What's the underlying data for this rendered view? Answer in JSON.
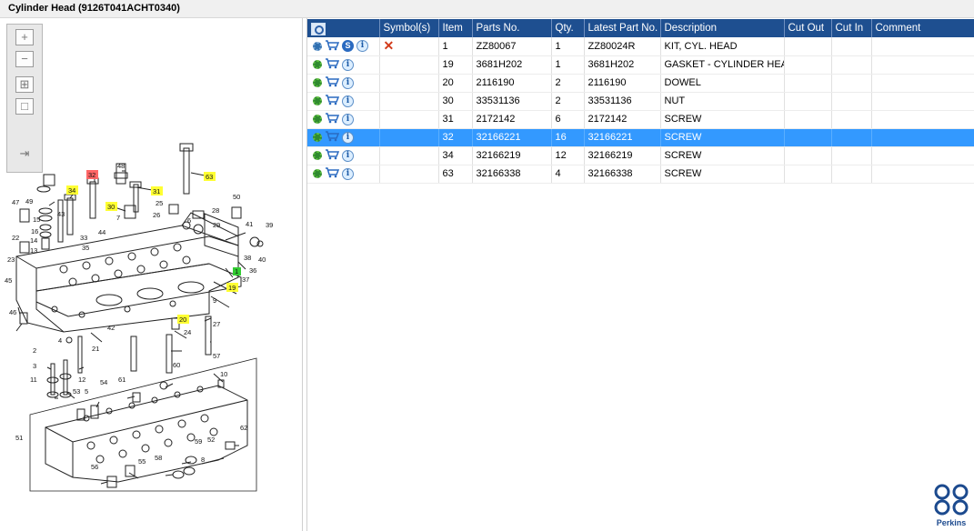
{
  "window": {
    "title": "Cylinder Head (9126T041ACHT0340)"
  },
  "toolbar": {
    "buttons": [
      {
        "name": "zoom-in",
        "glyph": "+"
      },
      {
        "name": "zoom-out",
        "glyph": "−"
      },
      {
        "name": "fit-all",
        "glyph": "⊞"
      },
      {
        "name": "actual-size",
        "glyph": "□"
      },
      {
        "name": "toggle-table",
        "glyph": "⇥"
      }
    ]
  },
  "table": {
    "columns": [
      "Symbol(s)",
      "Item",
      "Parts No.",
      "Qty.",
      "Latest Part No.",
      "Description",
      "Cut Out",
      "Cut In",
      "Comment"
    ],
    "rows": [
      {
        "icons": [
          "gear-pair",
          "cart",
          "s-badge",
          "info"
        ],
        "symbol": "✕",
        "item": "1",
        "part": "ZZ80067",
        "qty": "1",
        "latest": "ZZ80024R",
        "desc": "KIT, CYL. HEAD",
        "cutout": "",
        "cutin": "",
        "comment": ""
      },
      {
        "icons": [
          "gear",
          "cart",
          "info"
        ],
        "symbol": "",
        "item": "19",
        "part": "3681H202",
        "qty": "1",
        "latest": "3681H202",
        "desc": "GASKET - CYLINDER HEAD",
        "cutout": "",
        "cutin": "",
        "comment": ""
      },
      {
        "icons": [
          "gear",
          "cart",
          "info"
        ],
        "symbol": "",
        "item": "20",
        "part": "2116190",
        "qty": "2",
        "latest": "2116190",
        "desc": "DOWEL",
        "cutout": "",
        "cutin": "",
        "comment": ""
      },
      {
        "icons": [
          "gear",
          "cart",
          "info"
        ],
        "symbol": "",
        "item": "30",
        "part": "33531136",
        "qty": "2",
        "latest": "33531136",
        "desc": "NUT",
        "cutout": "",
        "cutin": "",
        "comment": ""
      },
      {
        "icons": [
          "gear",
          "cart",
          "info"
        ],
        "symbol": "",
        "item": "31",
        "part": "2172142",
        "qty": "6",
        "latest": "2172142",
        "desc": "SCREW",
        "cutout": "",
        "cutin": "",
        "comment": ""
      },
      {
        "icons": [
          "gear",
          "cart",
          "info"
        ],
        "symbol": "",
        "item": "32",
        "part": "32166221",
        "qty": "16",
        "latest": "32166221",
        "desc": "SCREW",
        "cutout": "",
        "cutin": "",
        "comment": "",
        "selected": true
      },
      {
        "icons": [
          "gear",
          "cart",
          "info"
        ],
        "symbol": "",
        "item": "34",
        "part": "32166219",
        "qty": "12",
        "latest": "32166219",
        "desc": "SCREW",
        "cutout": "",
        "cutin": "",
        "comment": ""
      },
      {
        "icons": [
          "gear",
          "cart",
          "info"
        ],
        "symbol": "",
        "item": "63",
        "part": "32166338",
        "qty": "4",
        "latest": "32166338",
        "desc": "SCREW",
        "cutout": "",
        "cutin": "",
        "comment": ""
      }
    ]
  },
  "diagram": {
    "callouts": [
      "48",
      "32",
      "31",
      "63",
      "34",
      "30",
      "49",
      "47",
      "15",
      "16",
      "14",
      "22",
      "13",
      "23",
      "43",
      "33",
      "35",
      "44",
      "7",
      "26",
      "25",
      "6",
      "28",
      "29",
      "50",
      "39",
      "41",
      "40",
      "38",
      "36",
      "37",
      "1",
      "19",
      "45",
      "46",
      "42",
      "9",
      "20",
      "24",
      "27",
      "2",
      "3",
      "4",
      "21",
      "11",
      "12",
      "5",
      "53",
      "54",
      "61",
      "60",
      "57",
      "10",
      "51",
      "52",
      "62",
      "59",
      "58",
      "55",
      "56",
      "8"
    ],
    "highlight_colors": {
      "yellow": "#ffff33",
      "red": "#ff6666",
      "green": "#33cc33"
    }
  },
  "brand": {
    "name": "Perkins"
  },
  "colors": {
    "header": "#1e4f90",
    "selection": "#3399ff"
  }
}
